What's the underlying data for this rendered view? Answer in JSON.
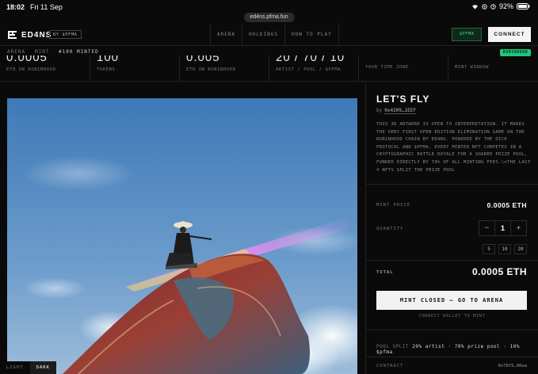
{
  "status_bar": {
    "time": "18:02",
    "date": "Fri 11 Sep",
    "battery": "92%"
  },
  "browser": {
    "url": "ed4ns.pfma.fun"
  },
  "header": {
    "logo": "ED4NS",
    "by_badge": "BY $PFMA",
    "nav": [
      "ARENA",
      "HOLDINGS",
      "HOW TO PLAY"
    ],
    "pfma_button": "$PFMA",
    "connect_button": "CONNECT"
  },
  "subnav": {
    "crumb1": "ARENA",
    "crumb2": "MINT",
    "minted": "#100 MINTED",
    "chain_badge": "ROBINHOOD"
  },
  "stats": [
    {
      "value": "0.0005",
      "label": "ETH ON ROBINHOOD"
    },
    {
      "value": "100",
      "label": "TOKENS"
    },
    {
      "value": "0.005",
      "label": "ETH ON ROBINHOOD"
    },
    {
      "value": "20 / 70 / 10",
      "label": "ARTIST / POOL / $PFMA"
    },
    {
      "value": "",
      "label": "YOUR TIME ZONE"
    },
    {
      "value": "",
      "label": "MINT WINDOW"
    }
  ],
  "artwork": {
    "title": "LET'S FLY",
    "by_label": "by",
    "creator": "0x4209…1EEF",
    "description": "THIS 3D ARTWORK IS OPEN TO INTERPRETATION. IT MARKS THE VERY FIRST OPEN EDITION ELIMINATION GAME ON THE ROBINHOOD CHAIN BY ED4NS. POWERED BY THE DICE PROTOCOL AND $PFMA. EVERY MINTED NFT COMPETES IN A CRYPTOGRAPHIC BATTLE ROYALE FOR A SHARED PRIZE POOL, FUNDED DIRECTLY BY 70% OF ALL MINTING FEES.\\nTHE LAST 4 NFTS SPLIT THE PRIZE POOL"
  },
  "mint": {
    "price_label": "MINT PRICE",
    "price_value": "0.0005 ETH",
    "quantity_label": "QUANTITY",
    "quantity": "1",
    "minus": "−",
    "plus": "+",
    "presets": [
      "5",
      "10",
      "20"
    ],
    "total_label": "TOTAL",
    "total_value": "0.0005 ETH",
    "mint_button": "MINT CLOSED — GO TO ARENA",
    "wallet_hint": "CONNECT WALLET TO MINT"
  },
  "pool_split": {
    "label": "POOL SPLIT",
    "value": "20% artist · 70% prize pool · 10% $pfma"
  },
  "contract": {
    "label": "CONTRACT",
    "value": "0x78f5…90ea"
  },
  "theme": {
    "light": "LIGHT",
    "dark": "DARK"
  },
  "colors": {
    "accent_green": "#22c67a",
    "background": "#0a0a0a",
    "sky": "#5f91c4"
  }
}
